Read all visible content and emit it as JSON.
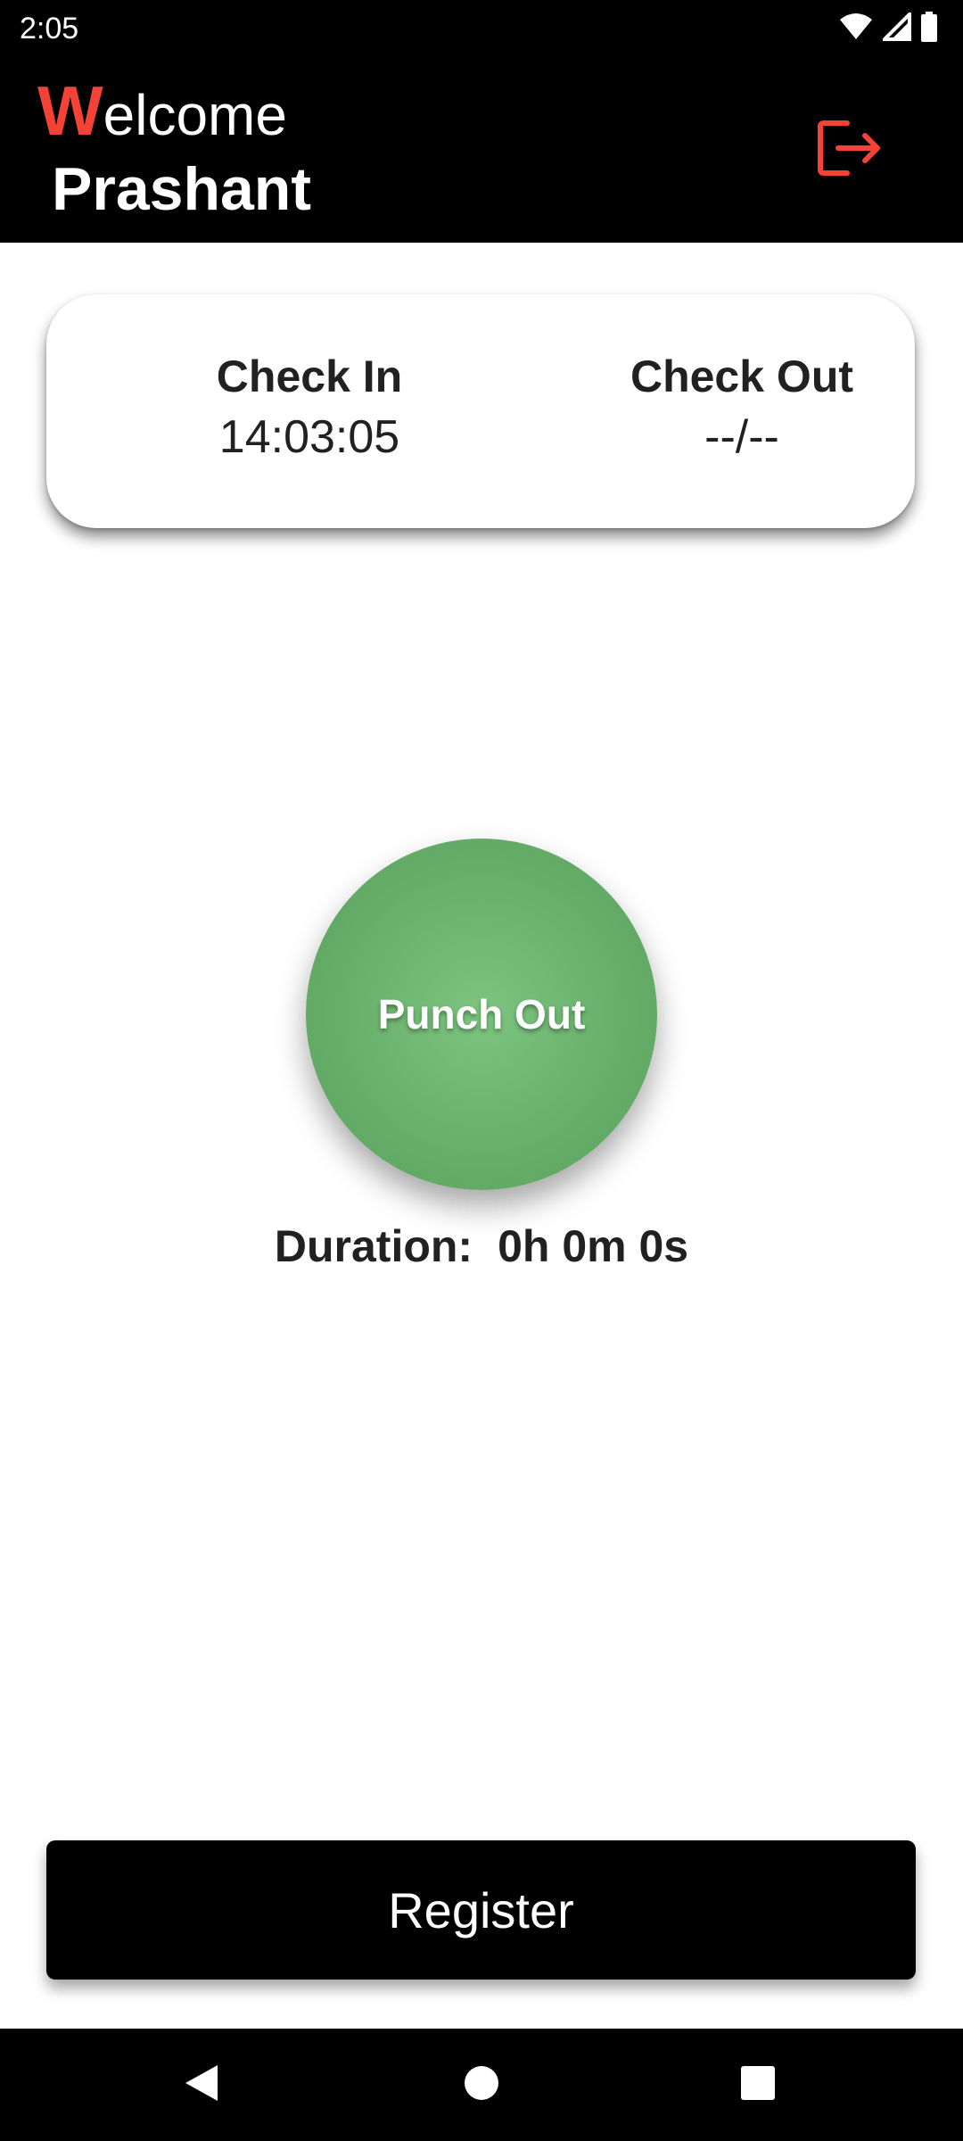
{
  "status_bar": {
    "time": "2:05",
    "icons": [
      "wifi-icon",
      "cell-signal-icon",
      "battery-icon"
    ]
  },
  "header": {
    "welcome_initial": "W",
    "welcome_rest": "elcome",
    "user_name": "Prashant",
    "logout_icon": "logout-icon"
  },
  "check_card": {
    "check_in_label": "Check In",
    "check_in_value": "14:03:05",
    "check_out_label": "Check Out",
    "check_out_value": "--/--"
  },
  "punch": {
    "label": "Punch Out"
  },
  "duration": {
    "label": "Duration:",
    "value": "0h 0m 0s"
  },
  "register": {
    "label": "Register"
  },
  "nav_bar": {
    "icons": [
      "back-icon",
      "home-icon",
      "recents-icon"
    ]
  },
  "colors": {
    "accent": "#f44336",
    "punch_green": "#6cb36f",
    "header_bg": "#000000"
  }
}
